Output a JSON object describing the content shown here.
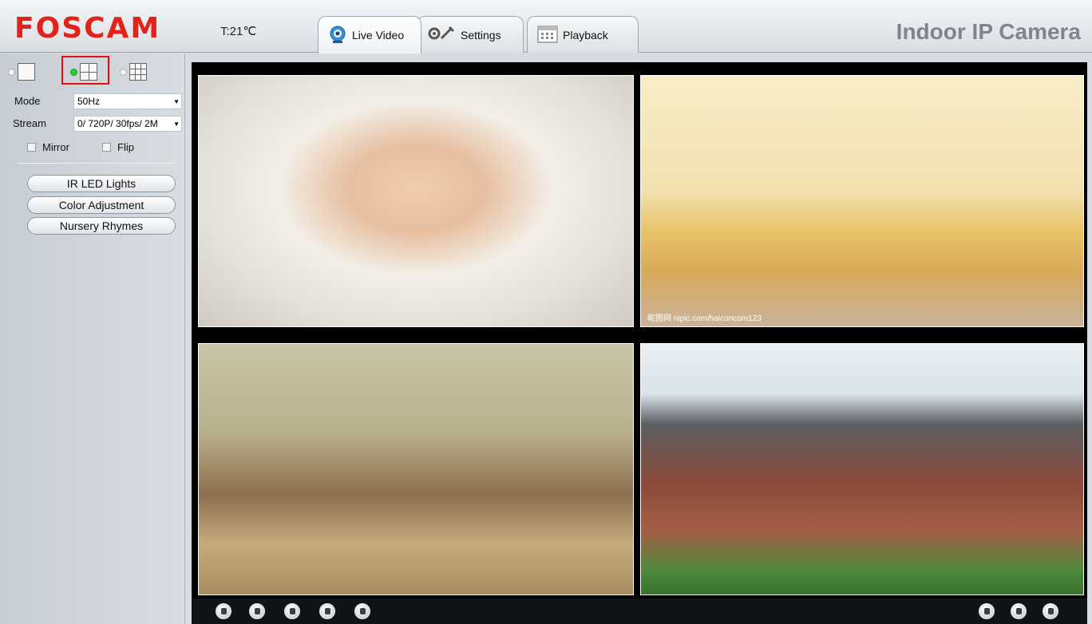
{
  "header": {
    "logo": "FOSCAM",
    "temperature": "T:21℃",
    "tabs": [
      {
        "label": "Live Video",
        "icon": "live-video-icon",
        "active": true
      },
      {
        "label": "Settings",
        "icon": "settings-wrench-icon",
        "active": false
      },
      {
        "label": "Playback",
        "icon": "calendar-icon",
        "active": false
      }
    ],
    "camera_title": "Indoor IP Camera"
  },
  "sidebar": {
    "split_options": [
      {
        "icon": "single-view-icon",
        "selected": false
      },
      {
        "icon": "quad-view-icon",
        "selected": true
      },
      {
        "icon": "nine-view-icon",
        "selected": false
      }
    ],
    "mode": {
      "label": "Mode",
      "value": "50Hz"
    },
    "stream": {
      "label": "Stream",
      "value": "0/ 720P/ 30fps/ 2M"
    },
    "mirror": {
      "label": "Mirror",
      "checked": false
    },
    "flip": {
      "label": "Flip",
      "checked": false
    },
    "buttons": {
      "ir_led": "IR LED Lights",
      "color_adjust": "Color Adjustment",
      "nursery": "Nursery Rhymes"
    }
  },
  "video": {
    "cells": [
      {
        "name": "camera-feed-1",
        "scene": "sleeping baby"
      },
      {
        "name": "camera-feed-2",
        "scene": "kids bedroom"
      },
      {
        "name": "camera-feed-3",
        "scene": "living room"
      },
      {
        "name": "camera-feed-4",
        "scene": "house exterior"
      }
    ],
    "watermark": "昵图网 nipic.com/haiconcom123"
  },
  "toolbar": {
    "left_icons": [
      "play-icon",
      "stop-icon",
      "audio-icon",
      "talk-icon",
      "microphone-icon"
    ],
    "right_icons": [
      "snapshot-icon",
      "record-icon",
      "fullscreen-icon"
    ]
  },
  "colors": {
    "brand": "#e2231a",
    "selected_radio": "#22d12a",
    "highlight_frame": "#e01010"
  }
}
